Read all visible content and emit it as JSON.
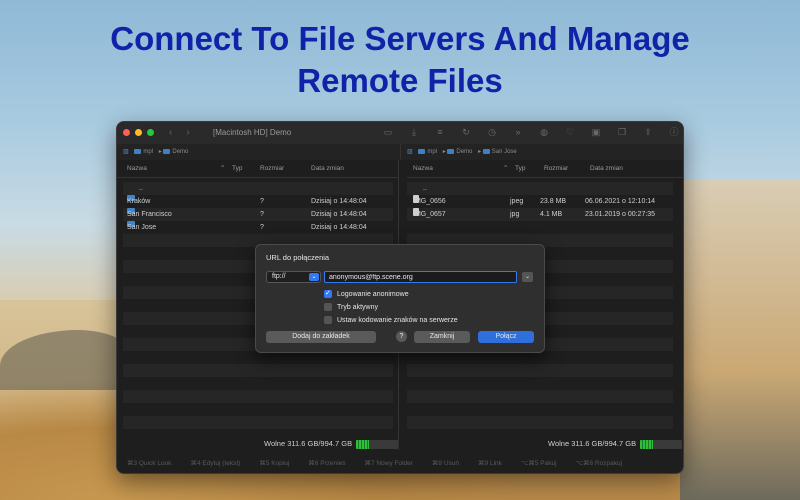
{
  "headline": {
    "line1": "Connect To File Servers And Manage",
    "line2": "Remote Files"
  },
  "window": {
    "title": "[Macintosh HD] Demo",
    "toolbar_icons": [
      "monitor-icon",
      "download-icon",
      "list-icon",
      "refresh-icon",
      "clock-icon",
      "forward-icon",
      "globe-icon",
      "heart-icon",
      "terminal-icon",
      "copy-icon",
      "share-icon",
      "info-icon"
    ]
  },
  "left_path": [
    "mpl",
    "Demo"
  ],
  "right_path": [
    "mpl",
    "Demo",
    "San Jose"
  ],
  "columns": {
    "name": "Nazwa",
    "type": "Typ",
    "size": "Rozmiar",
    "date": "Data zmian"
  },
  "left_rows": [
    {
      "name": "..",
      "type": "",
      "size": "",
      "date": ""
    },
    {
      "name": "Kraków",
      "type": "",
      "size": "?",
      "date": "Dzisiaj o 14:48:04"
    },
    {
      "name": "San Francisco",
      "type": "",
      "size": "?",
      "date": "Dzisiaj o 14:48:04"
    },
    {
      "name": "San Jose",
      "type": "",
      "size": "?",
      "date": "Dzisiaj o 14:48:04"
    }
  ],
  "right_rows": [
    {
      "name": "..",
      "type": "",
      "size": "",
      "date": ""
    },
    {
      "name": "IMG_0656",
      "type": "jpeg",
      "size": "23.8 MB",
      "date": "06.06.2021 o 12:10:14"
    },
    {
      "name": "IMG_0657",
      "type": "jpg",
      "size": "4.1 MB",
      "date": "23.01.2019 o 00:27:35"
    }
  ],
  "left_free": "Wolne 311.6 GB/994.7 GB",
  "right_free": "Wolne 311.6 GB/994.7 GB",
  "free_fraction": 0.31,
  "fn_keys": [
    "⌘3 Quick Look",
    "⌘4 Edytuj (tekst)",
    "⌘5 Kopiuj",
    "⌘6 Przenieś",
    "⌘7 Nowy Folder",
    "⌘8 Usuń",
    "⌘9 Link",
    "⌥⌘5 Pakuj",
    "⌥⌘6 Rozpakuj"
  ],
  "dialog": {
    "title": "URL do połączenia",
    "protocol": "ftp://",
    "url": "anonymous@ftp.scene.org",
    "options": [
      {
        "label": "Logowanie anonimowe",
        "checked": true
      },
      {
        "label": "Tryb aktywny",
        "checked": false
      },
      {
        "label": "Ustaw kodowanie znaków na serwerze",
        "checked": false
      }
    ],
    "bookmark_label": "Dodaj do zakładek",
    "help_label": "?",
    "close_label": "Zamknij",
    "connect_label": "Połącz"
  }
}
